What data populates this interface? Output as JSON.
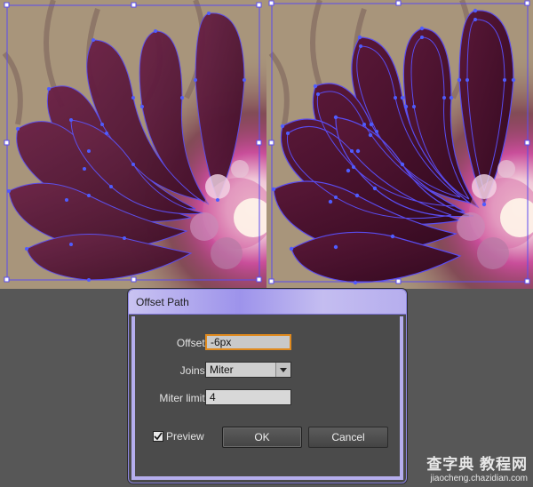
{
  "dialog": {
    "title": "Offset Path",
    "offset_label": "Offset:",
    "offset_value": "-6px",
    "joins_label": "Joins:",
    "joins_value": "Miter",
    "miter_limit_label": "Miter limit:",
    "miter_limit_value": "4",
    "preview_label": "Preview",
    "preview_checked": true,
    "ok_label": "OK",
    "cancel_label": "Cancel"
  },
  "watermark": {
    "line1": "查字典 教程网",
    "line2": "jiaocheng.chazidian.com"
  },
  "colors": {
    "artboard_bg": "#a8957b",
    "petal": "#5a1838",
    "path_stroke": "#5a4cf0",
    "anchor": "#4f5cff",
    "dialog_bg": "#4a4a4a",
    "workspace": "#575757",
    "focus": "#e08a1e"
  }
}
